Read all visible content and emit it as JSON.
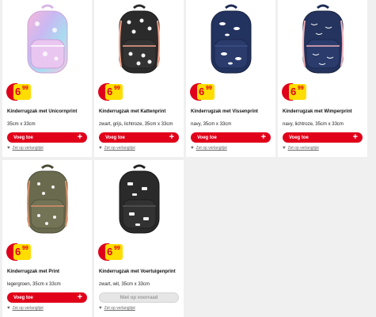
{
  "products": [
    {
      "name": "Kinderrugzak met Unicornprint",
      "details": "35cm x 33cm",
      "price_main": "6",
      "price_cents": "99",
      "button_label": "Voeg toe",
      "button_plus": "+",
      "wishlist_label": "Zet op verlanglijst",
      "available": true
    },
    {
      "name": "Kinderrugzak met Kattenprint",
      "details": "zwart, grijs, lichtroze, 35cm x 33cm",
      "price_main": "6",
      "price_cents": "99",
      "button_label": "Voeg toe",
      "button_plus": "+",
      "wishlist_label": "Zet op verlanglijst",
      "available": true
    },
    {
      "name": "Kinderrugzak met Vissenprint",
      "details": "navy, 35cm x 33cm",
      "price_main": "6",
      "price_cents": "99",
      "button_label": "Voeg toe",
      "button_plus": "+",
      "wishlist_label": "Zet op verlanglijst",
      "available": true
    },
    {
      "name": "Kinderrugzak met Wimperprint",
      "details": "navy, lichtroze, 35cm x 33cm",
      "price_main": "6",
      "price_cents": "99",
      "button_label": "Voeg toe",
      "button_plus": "+",
      "wishlist_label": "Zet op verlanglijst",
      "available": true
    },
    {
      "name": "Kinderrugzak met Print",
      "details": "legergroen, 35cm x 33cm",
      "price_main": "6",
      "price_cents": "99",
      "button_label": "Voeg toe",
      "button_plus": "+",
      "wishlist_label": "Zet op verlanglijst",
      "available": true
    },
    {
      "name": "Kinderrugzak met Voertuigenprint",
      "details": "zwart, wit, 35cm x 33cm",
      "price_main": "6",
      "price_cents": "99",
      "button_label": "Niet op voorraad",
      "wishlist_label": "Zet op verlanglijst",
      "available": false
    }
  ],
  "colors": {
    "brand_red": "#e1001a",
    "price_yellow": "#ffdd00",
    "page_background": "#f0f0f0"
  },
  "icons": {
    "wishlist": "heart-icon",
    "add": "plus-icon"
  }
}
